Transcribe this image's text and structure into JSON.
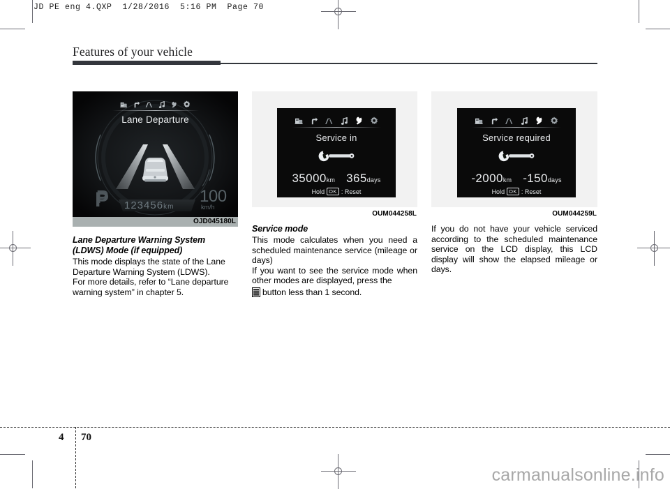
{
  "prepress": {
    "slug": "JD PE eng 4.QXP  1/28/2016  5:16 PM  Page 70"
  },
  "header": {
    "chapter_title": "Features of your vehicle"
  },
  "footer": {
    "chapter_number": "4",
    "page_number": "70",
    "watermark": "carmanualsonline.info"
  },
  "columns": [
    {
      "figure": {
        "caption": "OJD045180L",
        "display": {
          "title": "Lane Departure",
          "gear": "P",
          "odometer": "123456",
          "odometer_unit": "km",
          "speed": "100",
          "speed_unit": "km/h",
          "icons": [
            "trip-computer-icon",
            "turn-arrow-icon",
            "lane-departure-icon",
            "music-note-icon",
            "wrench-icon",
            "gear-icon"
          ]
        }
      },
      "heading": "Lane Departure Warning System (LDWS) Mode (if equipped)",
      "paragraphs": [
        "This mode displays the state of the Lane Departure Warning System (LDWS).",
        "For more details, refer to “Lane departure warning system” in chapter 5."
      ]
    },
    {
      "figure": {
        "caption": "OUM044258L",
        "display": {
          "title": "Service in",
          "distance_value": "35000",
          "distance_unit": "km",
          "days_value": "365",
          "days_unit": "days",
          "hint_prefix": "Hold",
          "hint_key": "OK",
          "hint_suffix": ": Reset",
          "icons": [
            "trip-computer-icon",
            "turn-arrow-icon",
            "lane-departure-icon",
            "music-note-icon",
            "wrench-icon",
            "gear-icon"
          ]
        }
      },
      "heading": "Service mode",
      "paragraphs": [
        "This mode calculates when you need a scheduled maintenance service (mileage or days)",
        "If you want to see the service mode when other modes are displayed, press the"
      ],
      "icon_sentence_tail": "button less than 1 second.",
      "inline_icon": "trip-computer-button-icon"
    },
    {
      "figure": {
        "caption": "OUM044259L",
        "display": {
          "title": "Service required",
          "distance_value": "-2000",
          "distance_unit": "km",
          "days_value": "-150",
          "days_unit": "days",
          "hint_prefix": "Hold",
          "hint_key": "OK",
          "hint_suffix": ": Reset",
          "icons": [
            "trip-computer-icon",
            "turn-arrow-icon",
            "lane-departure-icon",
            "music-note-icon",
            "wrench-icon",
            "gear-icon"
          ]
        }
      },
      "heading": "",
      "paragraphs": [
        "If you do not have your vehicle serviced according to the scheduled maintenance service on the LCD display,  this LCD display will show the elapsed mileage or days."
      ]
    }
  ]
}
